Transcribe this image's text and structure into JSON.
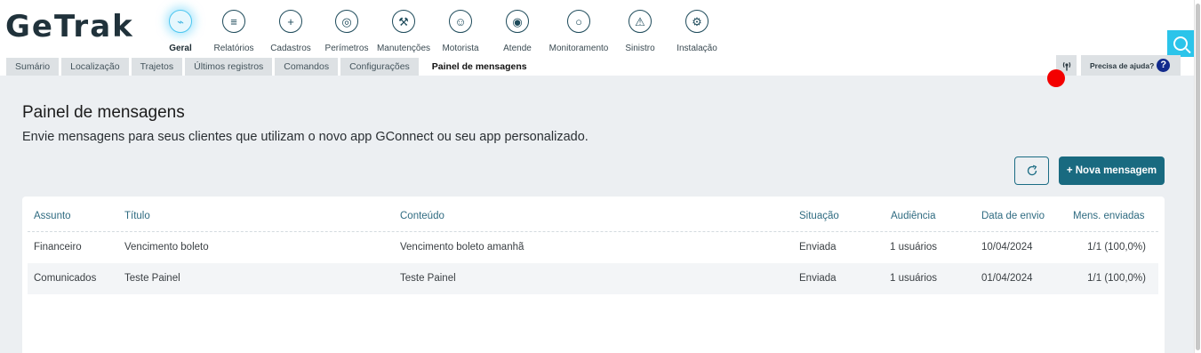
{
  "app": {
    "logo_text": "GeTrak"
  },
  "modules": [
    {
      "label": "Geral",
      "icon": "monitor-chart-icon",
      "glyph": "⌁",
      "active": true
    },
    {
      "label": "Relatórios",
      "icon": "report-icon",
      "glyph": "≡",
      "active": false
    },
    {
      "label": "Cadastros",
      "icon": "folder-add-icon",
      "glyph": "+",
      "active": false
    },
    {
      "label": "Perímetros",
      "icon": "target-icon",
      "glyph": "◎",
      "active": false
    },
    {
      "label": "Manutenções",
      "icon": "wrench-icon",
      "glyph": "⚒",
      "active": false
    },
    {
      "label": "Motorista",
      "icon": "driver-icon",
      "glyph": "☺",
      "active": false
    },
    {
      "label": "Atende",
      "icon": "radar-icon",
      "glyph": "◉",
      "active": false
    },
    {
      "label": "Monitoramento",
      "icon": "monitoring-icon",
      "glyph": "○",
      "active": false
    },
    {
      "label": "Sinistro",
      "icon": "alarm-icon",
      "glyph": "⚠",
      "active": false
    },
    {
      "label": "Instalação",
      "icon": "installer-icon",
      "glyph": "⚙",
      "active": false
    }
  ],
  "tabs": [
    {
      "label": "Sumário",
      "active": false
    },
    {
      "label": "Localização",
      "active": false
    },
    {
      "label": "Trajetos",
      "active": false
    },
    {
      "label": "Últimos registros",
      "active": false
    },
    {
      "label": "Comandos",
      "active": false
    },
    {
      "label": "Configurações",
      "active": false
    },
    {
      "label": "Painel de mensagens",
      "active": true
    }
  ],
  "help": {
    "label": "Precisa de ajuda?",
    "icon": "question-icon",
    "glyph": "?"
  },
  "signal": {
    "icon": "signal-icon"
  },
  "search": {
    "icon": "search-icon"
  },
  "page": {
    "title": "Painel de mensagens",
    "subtitle": "Envie mensagens para seus clientes que utilizam o novo app GConnect ou seu app personalizado."
  },
  "actions": {
    "refresh_icon": "refresh-icon",
    "new_message_label": "+ Nova mensagem"
  },
  "table": {
    "columns": [
      "Assunto",
      "Título",
      "Conteúdo",
      "Situação",
      "Audiência",
      "Data de envio",
      "Mens. enviadas"
    ],
    "rows": [
      [
        "Financeiro",
        "Vencimento boleto",
        "Vencimento boleto amanhã",
        "Enviada",
        "1 usuários",
        "10/04/2024",
        "1/1 (100,0%)"
      ],
      [
        "Comunicados",
        "Teste Painel",
        "Teste Painel",
        "Enviada",
        "1 usuários",
        "01/04/2024",
        "1/1 (100,0%)"
      ]
    ]
  },
  "colors": {
    "brand_dark": "#20323b",
    "accent_cyan": "#2bc4ea",
    "primary_button": "#196a80",
    "header_text": "#2f6b81",
    "alert_red": "#f30000",
    "help_icon": "#122a8c",
    "page_background": "#eceff2"
  }
}
